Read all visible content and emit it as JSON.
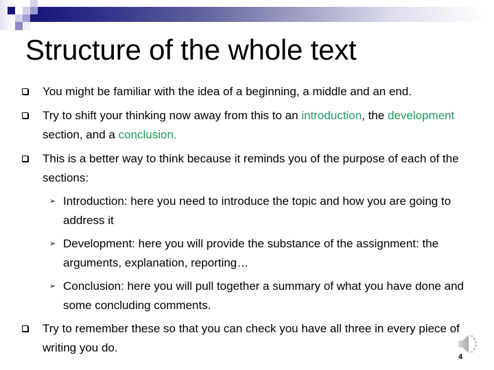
{
  "slide": {
    "title": "Structure of the whole text",
    "slide_number": "4",
    "colors": {
      "header_navy": "#16167a",
      "highlight_green": "#1f9a5c",
      "text": "#000000"
    },
    "icons": {
      "bullet_primary": "hollow-square-bullet",
      "bullet_secondary": "arrowhead-bullet",
      "audio": "speaker-icon"
    },
    "bullets": [
      {
        "text": "You might be familiar with the idea of a beginning, a middle and an end."
      },
      {
        "parts": {
          "p1": "Try to shift your thinking now away from this to an ",
          "k1": "introduction",
          "p2": ", the ",
          "k2": "development",
          "p3": " section, and a ",
          "k3": "conclusion."
        }
      },
      {
        "text": "This is a better way to think because it reminds you of the purpose of each of the sections:",
        "sub_bullets": [
          {
            "text": "Introduction: here you need to introduce the topic and how you are going to address it"
          },
          {
            "text": "Development: here you will provide the substance of the assignment: the arguments, explanation, reporting…"
          },
          {
            "text": "Conclusion: here you will pull together a summary of what you have done and some concluding comments."
          }
        ]
      },
      {
        "text": "Try to remember these so that you can check you have all three in every piece of writing you do."
      }
    ]
  }
}
